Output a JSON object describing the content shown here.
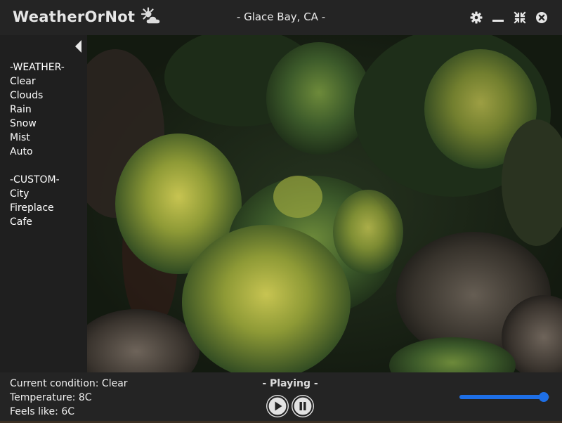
{
  "app": {
    "title": "WeatherOrNot",
    "location": "- Glace Bay, CA -",
    "logo_icon": "sun-cloud-icon"
  },
  "window_controls": [
    "settings-gear-icon",
    "minimize-icon",
    "restore-icon",
    "close-icon"
  ],
  "sidebar": {
    "collapse_icon": "triangle-left-icon",
    "weather_header": "-WEATHER-",
    "weather_items": [
      "Clear",
      "Clouds",
      "Rain",
      "Snow",
      "Mist",
      "Auto"
    ],
    "custom_header": "-CUSTOM-",
    "custom_items": [
      "City",
      "Fireplace",
      "Cafe"
    ]
  },
  "video": {
    "description_icon": "forest-aerial-video"
  },
  "status": {
    "condition": "Current condition: Clear",
    "temperature": "Temperature: 8C",
    "feels_like": "Feels like: 6C"
  },
  "player": {
    "state": "- Playing -",
    "play_icon": "play-icon",
    "pause_icon": "pause-icon",
    "volume": 1.0
  },
  "colors": {
    "accent": "#1e6fe6",
    "bar_bg": "#242424"
  }
}
